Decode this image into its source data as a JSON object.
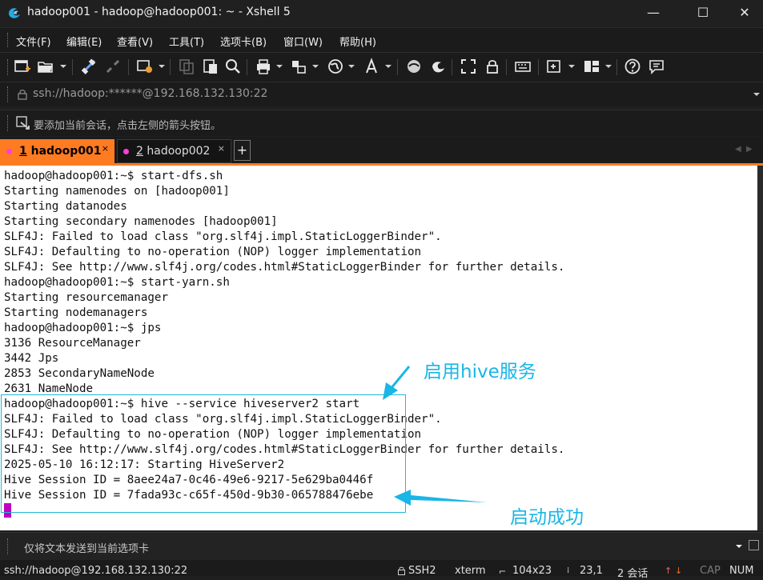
{
  "window": {
    "title": "hadoop001 - hadoop@hadoop001: ~ - Xshell 5",
    "minimize": "—",
    "maximize": "☐",
    "close": "✕"
  },
  "menu": [
    "文件(F)",
    "编辑(E)",
    "查看(V)",
    "工具(T)",
    "选项卡(B)",
    "窗口(W)",
    "帮助(H)"
  ],
  "address": {
    "text": "ssh://hadoop:******@192.168.132.130:22"
  },
  "hint": {
    "text": "要添加当前会话，点击左侧的箭头按钮。"
  },
  "tabs": [
    {
      "number": "1",
      "label": " hadoop001",
      "close": "×"
    },
    {
      "number": "2",
      "label": " hadoop002",
      "close": "×"
    }
  ],
  "tab_add": "+",
  "tab_nav": {
    "prev": "◀",
    "next": "▶"
  },
  "terminal": {
    "lines": [
      "hadoop@hadoop001:~$ start-dfs.sh",
      "Starting namenodes on [hadoop001]",
      "Starting datanodes",
      "Starting secondary namenodes [hadoop001]",
      "SLF4J: Failed to load class \"org.slf4j.impl.StaticLoggerBinder\".",
      "SLF4J: Defaulting to no-operation (NOP) logger implementation",
      "SLF4J: See http://www.slf4j.org/codes.html#StaticLoggerBinder for further details.",
      "hadoop@hadoop001:~$ start-yarn.sh",
      "Starting resourcemanager",
      "Starting nodemanagers",
      "hadoop@hadoop001:~$ jps",
      "3136 ResourceManager",
      "3442 Jps",
      "2853 SecondaryNameNode",
      "2631 NameNode",
      "hadoop@hadoop001:~$ hive --service hiveserver2 start",
      "SLF4J: Failed to load class \"org.slf4j.impl.StaticLoggerBinder\".",
      "SLF4J: Defaulting to no-operation (NOP) logger implementation",
      "SLF4J: See http://www.slf4j.org/codes.html#StaticLoggerBinder for further details.",
      "2025-05-10 16:12:17: Starting HiveServer2",
      "Hive Session ID = 8aee24a7-0c46-49e6-9217-5e629ba0446f",
      "Hive Session ID = 7fada93c-c65f-450d-9b30-065788476ebe"
    ]
  },
  "annotations": {
    "start_hive": "启用hive服务",
    "started": "启动成功",
    "color": "#19b6e6"
  },
  "send_bar": {
    "text": "仅将文本发送到当前选项卡"
  },
  "status": {
    "connection": "ssh://hadoop@192.168.132.130:22",
    "protocol": "SSH2",
    "terminal": "xterm",
    "size": "104x23",
    "position": "23,1",
    "sessions": "2 会话",
    "caps": "CAP",
    "num": "NUM"
  },
  "colors": {
    "accent_tab": "#ff7b22",
    "tab_dot": "#ff3dd8",
    "cursor": "#c000c0"
  }
}
